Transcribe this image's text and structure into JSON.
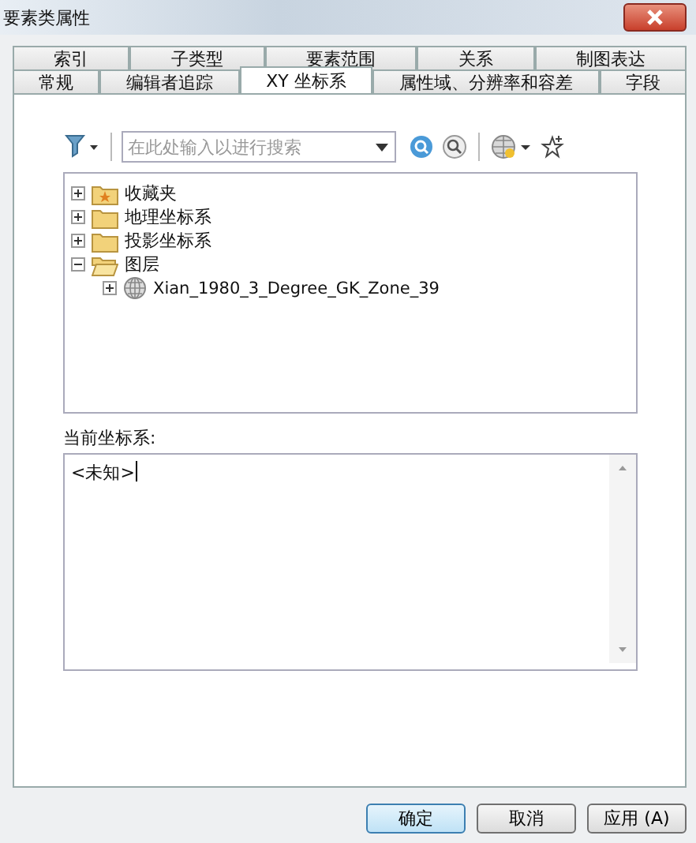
{
  "window": {
    "title": "要素类属性"
  },
  "tab_rows": [
    [
      {
        "label": "索引",
        "selected": false
      },
      {
        "label": "子类型",
        "selected": false
      },
      {
        "label": "要素范围",
        "selected": false
      },
      {
        "label": "关系",
        "selected": false
      },
      {
        "label": "制图表达",
        "selected": false
      }
    ],
    [
      {
        "label": "常规",
        "selected": false
      },
      {
        "label": "编辑者追踪",
        "selected": false
      },
      {
        "label": "XY 坐标系",
        "selected": true
      },
      {
        "label": "属性域、分辨率和容差",
        "selected": false
      },
      {
        "label": "字段",
        "selected": false
      }
    ]
  ],
  "search": {
    "placeholder": "在此处输入以进行搜索"
  },
  "tree": [
    {
      "label": "收藏夹",
      "kind": "favorites",
      "expanded": false
    },
    {
      "label": "地理坐标系",
      "kind": "folder",
      "expanded": false
    },
    {
      "label": "投影坐标系",
      "kind": "folder",
      "expanded": false
    },
    {
      "label": "图层",
      "kind": "folder",
      "expanded": true,
      "children": [
        {
          "label": "Xian_1980_3_Degree_GK_Zone_39",
          "kind": "globe",
          "expanded": false
        }
      ]
    }
  ],
  "current": {
    "label": "当前坐标系:",
    "value": "<未知>"
  },
  "buttons": [
    {
      "label": "确定",
      "default": true
    },
    {
      "label": "取消",
      "default": false
    },
    {
      "label": "应用 (A)",
      "default": false
    }
  ]
}
